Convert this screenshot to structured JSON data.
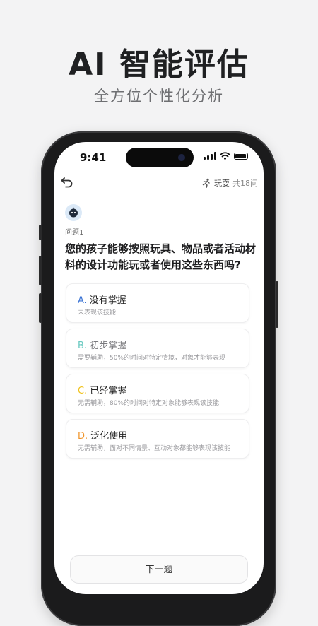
{
  "promo": {
    "headline": "AI 智能评估",
    "subline": "全方位个性化分析"
  },
  "status_bar": {
    "time": "9:41"
  },
  "header": {
    "category": "玩耍",
    "count": "共18问",
    "back_icon": "back-arrow-icon",
    "category_icon": "runner-icon"
  },
  "question": {
    "number": "问题1",
    "text": "您的孩子能够按照玩具、物品或者活动材料的设计功能玩或者使用这些东西吗?"
  },
  "options": [
    {
      "letter": "A.",
      "title": "没有掌握",
      "desc": "未表现该技能",
      "color": "#3a73d4",
      "title_color": "#222222"
    },
    {
      "letter": "B.",
      "title": "初步掌握",
      "desc": "需要辅助，50%的时间对特定情境，对象才能够表现",
      "color": "#68c9c0",
      "title_color": "#7a7a7e"
    },
    {
      "letter": "C.",
      "title": "已经掌握",
      "desc": "无需辅助，80%的时间对特定对象能够表现该技能",
      "color": "#f0c21c",
      "title_color": "#222222"
    },
    {
      "letter": "D.",
      "title": "泛化使用",
      "desc": "无需辅助，面对不同情景、互动对象都能够表现该技能",
      "color": "#f0952c",
      "title_color": "#222222"
    }
  ],
  "bottom": {
    "label": "下一题"
  }
}
